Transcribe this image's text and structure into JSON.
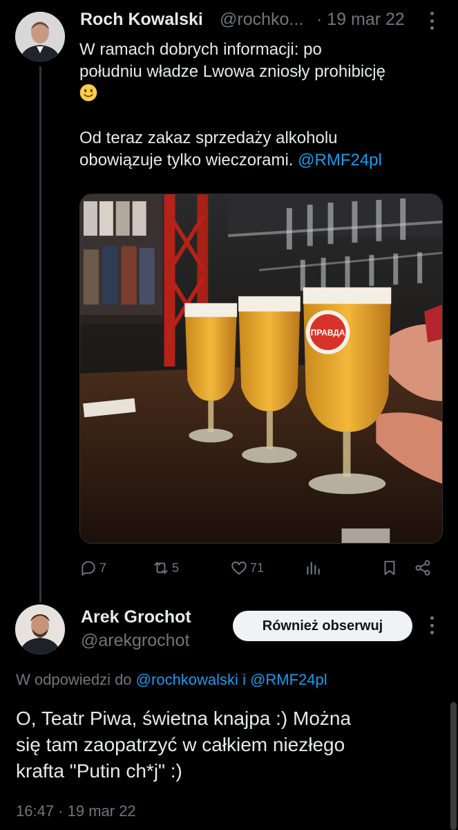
{
  "tweet": {
    "author_name": "Roch Kowalski",
    "author_handle": "@rochko...",
    "date": "· 19 mar 22",
    "text_line1": "W ramach dobrych informacji: po",
    "text_line2": "południu władze Lwowa zniosły prohibicję",
    "text_line3": "Od teraz zakaz sprzedaży alkoholu",
    "text_line4": "obowiązuje tylko wieczorami.",
    "mention": "@RMF24pl",
    "emoji": "slightly-smiling-face",
    "media": {
      "label": "ПРАВДА"
    },
    "actions": {
      "reply_count": "7",
      "retweet_count": "5",
      "like_count": "71",
      "views_icon": "bar-chart-icon",
      "bookmark_icon": "bookmark-icon",
      "share_icon": "share-icon"
    }
  },
  "reply": {
    "author_name": "Arek Grochot",
    "author_handle": "@arekgrochot",
    "follow_label": "Również obserwuj",
    "reply_to_prefix": "W odpowiedzi do",
    "reply_to_user1": "@rochkowalski",
    "reply_to_joiner": "i",
    "reply_to_user2": "@RMF24pl",
    "text_line1": "O, Teatr Piwa, świetna knajpa :) Można",
    "text_line2": "się tam zaopatrzyć w całkiem niezłego",
    "text_line3": "krafta \"Putin ch*j\" :)",
    "timestamp": "16:47 · 19 mar 22"
  },
  "colors": {
    "background": "#000000",
    "text": "#e7e9ea",
    "secondary": "#71767b",
    "link": "#1d9bf0"
  }
}
